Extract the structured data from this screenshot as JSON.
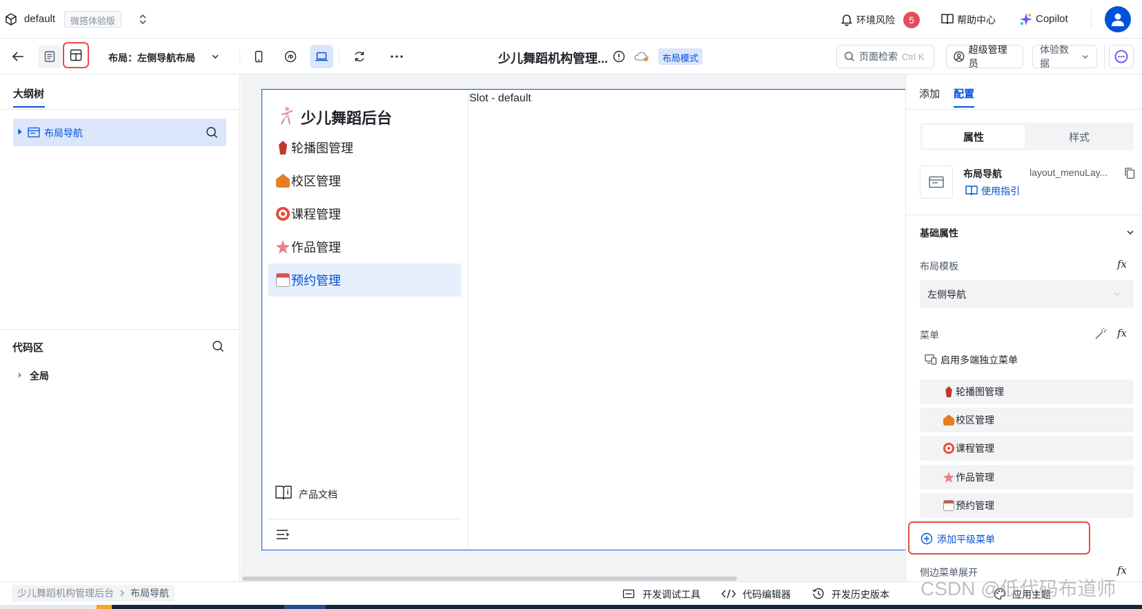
{
  "topbar": {
    "app_name": "default",
    "edition_badge": "微搭体验版",
    "env_risk_label": "环境风险",
    "env_risk_count": "5",
    "help_label": "帮助中心",
    "copilot_label": "Copilot"
  },
  "toolbar": {
    "layout_label": "布局：左侧导航布局",
    "page_title": "少儿舞蹈机构管理...",
    "layout_mode_tag": "布局模式",
    "search_placeholder": "页面检索",
    "search_shortcut": "Ctrl K",
    "admin_label": "超级管理员",
    "data_label": "体验数据"
  },
  "left_panel": {
    "outline_tab": "大纲树",
    "outline_item": "布局导航",
    "code_section": "代码区",
    "code_item": "全局"
  },
  "preview": {
    "brand": "少儿舞蹈后台",
    "slot_label": "Slot - default",
    "menu": [
      {
        "label": "轮播图管理",
        "icon": "dancer-icon",
        "color": "#c0392b"
      },
      {
        "label": "校区管理",
        "icon": "school-icon",
        "color": "#e67e22"
      },
      {
        "label": "课程管理",
        "icon": "target-icon",
        "color": "#e74c3c"
      },
      {
        "label": "作品管理",
        "icon": "starfish-icon",
        "color": "#e8828a"
      },
      {
        "label": "预约管理",
        "icon": "calendar-icon",
        "color": "#d9534f"
      }
    ],
    "docs_label": "产品文档"
  },
  "right_panel": {
    "tab_add": "添加",
    "tab_config": "配置",
    "seg_props": "属性",
    "seg_style": "样式",
    "component_name": "布局导航",
    "component_id": "layout_menuLay...",
    "guide_link": "使用指引",
    "basic_props": "基础属性",
    "layout_template_label": "布局模板",
    "layout_template_value": "左侧导航",
    "menu_label": "菜单",
    "multi_menu_label": "启用多端独立菜单",
    "menu_items": [
      "轮播图管理",
      "校区管理",
      "课程管理",
      "作品管理",
      "预约管理"
    ],
    "add_menu": "添加平级菜单",
    "side_expand": "侧边菜单展开"
  },
  "statusbar": {
    "breadcrumb_root": "少儿舞蹈机构管理后台",
    "breadcrumb_leaf": "布局导航",
    "debug_tool": "开发调试工具",
    "code_editor": "代码编辑器",
    "history": "开发历史版本",
    "theme": "应用主题"
  },
  "watermark": "CSDN @低代码布道师",
  "colors": {
    "primary": "#0052d9",
    "badge_red": "#e34d59",
    "highlight_red": "#e34d45",
    "selected_bg": "#dbe6fb"
  }
}
